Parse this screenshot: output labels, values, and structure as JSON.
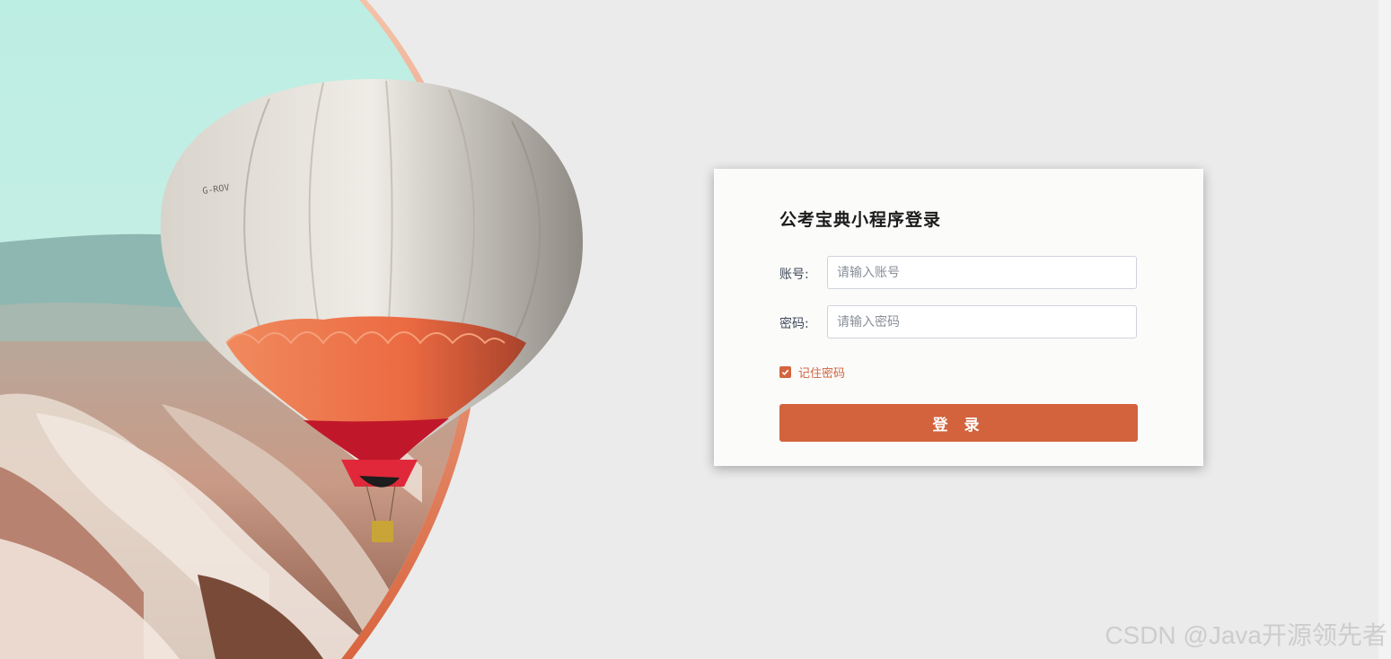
{
  "login": {
    "title": "公考宝典小程序登录",
    "account_label": "账号:",
    "account_placeholder": "请输入账号",
    "password_label": "密码:",
    "password_placeholder": "请输入密码",
    "remember_label": "记住密码",
    "remember_checked": true,
    "submit_label": "登 录"
  },
  "hero": {
    "image": "hot-air-balloon-over-rocky-valley",
    "balloon_marking": "G-ROV"
  },
  "watermark": "CSDN @Java开源领先者",
  "colors": {
    "accent": "#d2633d",
    "page_background": "#ebebeb",
    "card_background": "#fbfbfa"
  }
}
